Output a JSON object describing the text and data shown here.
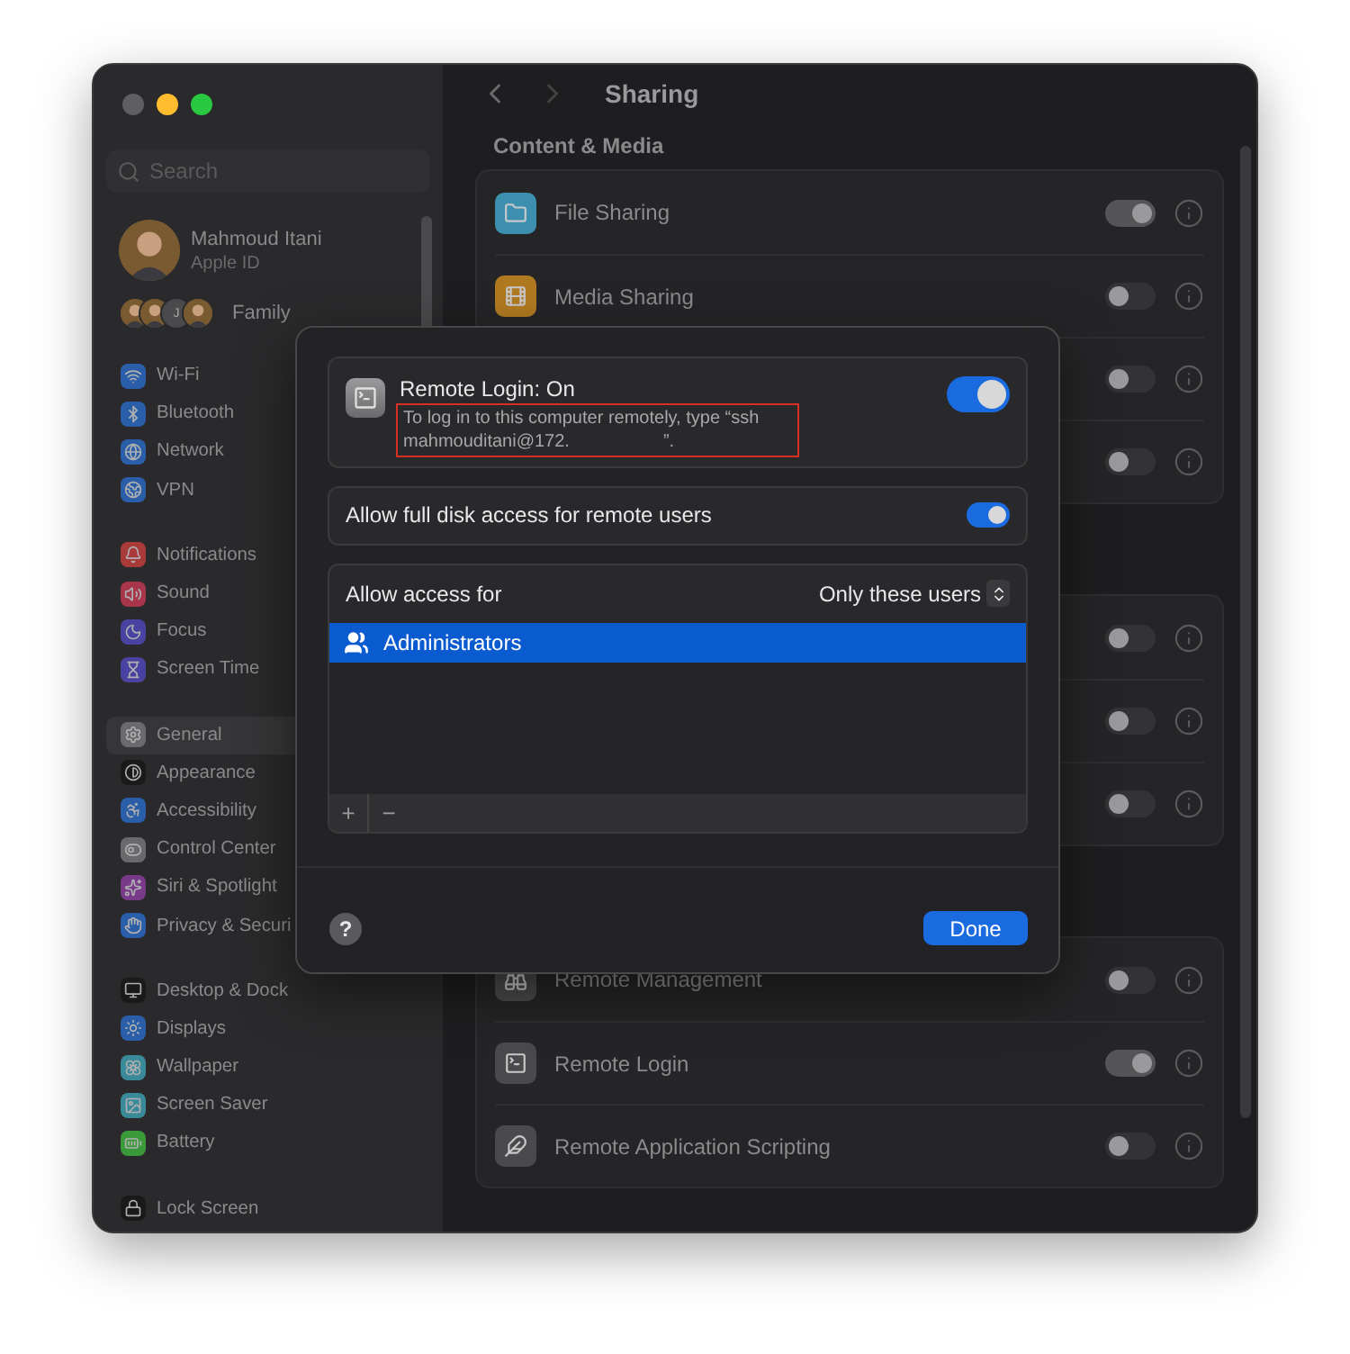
{
  "window": {
    "title": "Sharing",
    "controls": [
      {
        "color": "#5f5f61"
      },
      {
        "color": "#febc2e"
      },
      {
        "color": "#28c840"
      }
    ]
  },
  "sidebar": {
    "search_placeholder": "Search",
    "account": {
      "name": "Mahmoud Itani",
      "subtitle": "Apple ID"
    },
    "family": {
      "label": "Family",
      "avatars": [
        {
          "kind": "picture"
        },
        {
          "kind": "picture"
        },
        {
          "kind": "initial",
          "text": "J"
        },
        {
          "kind": "picture"
        }
      ]
    },
    "groups": [
      {
        "items": [
          {
            "label": "Wi-Fi",
            "color": "#2a5ea8",
            "selected": false
          },
          {
            "label": "Bluetooth",
            "color": "#2a5ea8",
            "selected": false
          },
          {
            "label": "Network",
            "color": "#2a5ea8",
            "selected": false
          },
          {
            "label": "VPN",
            "color": "#2a5ea8",
            "selected": false
          }
        ]
      },
      {
        "items": [
          {
            "label": "Notifications",
            "color": "#a83a3a",
            "selected": false
          },
          {
            "label": "Sound",
            "color": "#a8364a",
            "selected": false
          },
          {
            "label": "Focus",
            "color": "#4a42a0",
            "selected": false
          },
          {
            "label": "Screen Time",
            "color": "#4a42a0",
            "selected": false
          }
        ]
      },
      {
        "items": [
          {
            "label": "General",
            "color": "#6a6a6c",
            "selected": true
          },
          {
            "label": "Appearance",
            "color": "#1a1a1a",
            "selected": false
          },
          {
            "label": "Accessibility",
            "color": "#2a5ea8",
            "selected": false
          },
          {
            "label": "Control Center",
            "color": "#6a6a6c",
            "selected": false
          },
          {
            "label": "Siri & Spotlight",
            "color": "#7a3a8a",
            "selected": false
          },
          {
            "label": "Privacy & Securi",
            "color": "#2a5ea8",
            "selected": false
          }
        ]
      },
      {
        "items": [
          {
            "label": "Desktop & Dock",
            "color": "#1a1a1a",
            "selected": false
          },
          {
            "label": "Displays",
            "color": "#2a5ea8",
            "selected": false
          },
          {
            "label": "Wallpaper",
            "color": "#3a8a9a",
            "selected": false
          },
          {
            "label": "Screen Saver",
            "color": "#3a8a9a",
            "selected": false
          },
          {
            "label": "Battery",
            "color": "#3a9a3a",
            "selected": false
          }
        ]
      },
      {
        "items": [
          {
            "label": "Lock Screen",
            "color": "#1a1a1a",
            "selected": false
          }
        ]
      }
    ]
  },
  "main": {
    "sections": [
      {
        "header": "Content & Media",
        "rows": [
          {
            "label": "File Sharing",
            "color": "#3d8fb0",
            "on": true
          },
          {
            "label": "Media Sharing",
            "color": "#b07a20",
            "on": false
          },
          {
            "on": false
          },
          {
            "on": false
          }
        ]
      },
      {
        "rows": [
          {
            "on": false
          },
          {
            "on": false
          },
          {
            "on": false
          }
        ]
      },
      {
        "rows": [
          {
            "label": "Remote Management",
            "color": "#4a4a4c",
            "on": false
          },
          {
            "label": "Remote Login",
            "color": "#4a4a4c",
            "on": true
          },
          {
            "label": "Remote Application Scripting",
            "color": "#4a4a4c",
            "on": false
          }
        ]
      }
    ]
  },
  "sheet": {
    "service": {
      "title": "Remote Login: On",
      "description_start": "To log in to this computer remotely, type “ssh mahmouditani@172.",
      "description_end": "”.",
      "highlighted": true,
      "on": true
    },
    "full_disk": {
      "label": "Allow full disk access for remote users",
      "on": true
    },
    "access": {
      "label": "Allow access for",
      "choice": "Only these users",
      "users": [
        {
          "name": "Administrators",
          "selected": true
        }
      ],
      "add": "+",
      "remove": "−"
    },
    "help": "?",
    "done": "Done"
  }
}
